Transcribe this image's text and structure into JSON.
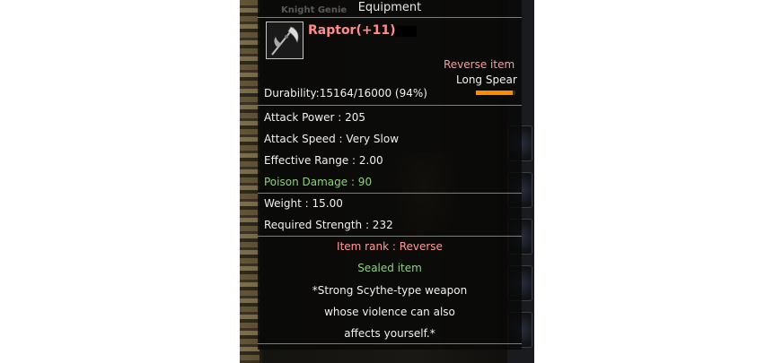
{
  "panel": {
    "title": "Equipment",
    "ghost_text": "Knight Genie"
  },
  "item": {
    "icon": "scythe-icon",
    "name": "Raptor(+11)",
    "grade": "Reverse item",
    "type": "Long Spear",
    "durability": "Durability:15164/16000 (94%)",
    "durability_fraction": 0.94
  },
  "stats": {
    "attack_power": "Attack Power : 205",
    "attack_speed": "Attack Speed : Very Slow",
    "effective_range": "Effective Range : 2.00",
    "poison_damage": "Poison Damage : 90",
    "weight": "Weight : 15.00",
    "required_strength": "Required Strength : 232"
  },
  "info": {
    "rank": "Item rank   : Reverse",
    "sealed": "Sealed item",
    "desc_1": "*Strong Scythe-type weapon",
    "desc_2": "whose violence can also",
    "desc_3": "affects yourself.*"
  },
  "colors": {
    "name": "#ff8c8c",
    "green": "#90d080",
    "bar": "#ff8a00"
  }
}
